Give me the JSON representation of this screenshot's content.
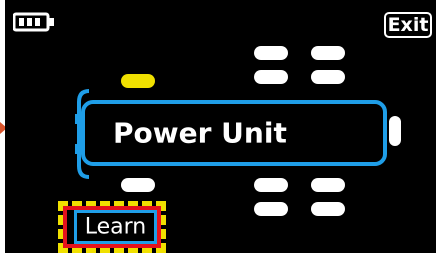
{
  "header": {
    "battery_icon": "battery-icon",
    "exit_label": "Exit"
  },
  "main": {
    "unit_label": "Power Unit",
    "learn_label": "Learn"
  },
  "colors": {
    "background": "#000000",
    "selection_blue": "#1f9ee8",
    "active_port_yellow": "#f0e000",
    "highlight_red": "#e5121c",
    "callout_orange": "#d9542b"
  }
}
